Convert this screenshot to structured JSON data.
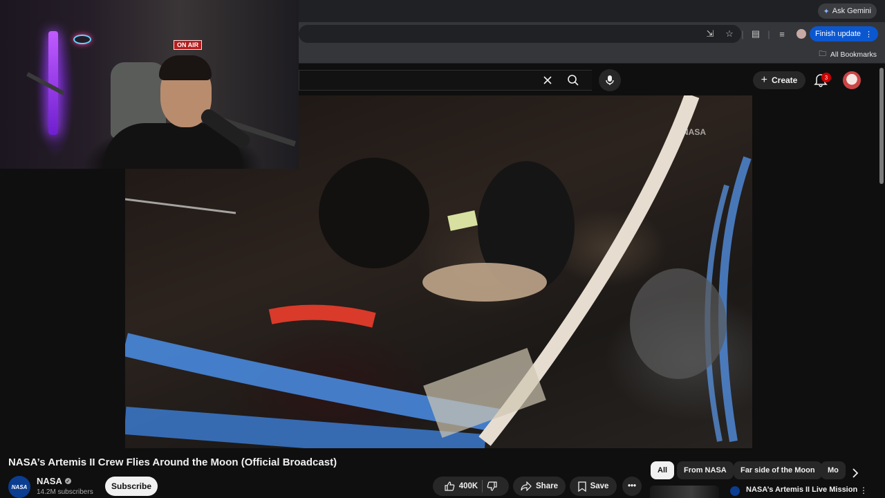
{
  "browser": {
    "gemini_label": "Ask Gemini",
    "finish_update_label": "Finish update",
    "bookmarks_label": "All Bookmarks"
  },
  "youtube_header": {
    "create_label": "Create",
    "notification_count": "3"
  },
  "webcam": {
    "sign_text": "ON AIR"
  },
  "video": {
    "title": "NASA’s Artemis II Crew Flies Around the Moon (Official Broadcast)",
    "watermark": "NASA"
  },
  "channel": {
    "name": "NASA",
    "subscribers": "14.2M subscribers",
    "subscribe_label": "Subscribe",
    "avatar_text": "NASA"
  },
  "actions": {
    "like_count": "400K",
    "share_label": "Share",
    "save_label": "Save"
  },
  "chips": [
    "All",
    "From NASA",
    "Far side of the Moon",
    "Mo"
  ],
  "recommendation": {
    "title": "NASA’s Artemis II Live Mission"
  },
  "colors": {
    "background": "#0f0f0f",
    "chip_active": "#f1f1f1",
    "subscribe_bg": "#f1f1f1",
    "notification_badge": "#cc0000",
    "finish_update": "#0b57d0"
  }
}
